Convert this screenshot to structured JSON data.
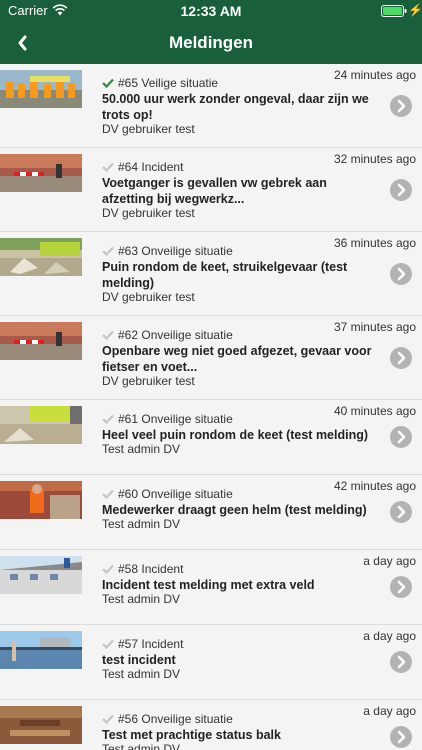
{
  "status_bar": {
    "carrier": "Carrier",
    "time": "12:33 AM"
  },
  "nav": {
    "title": "Meldingen"
  },
  "meldingen": [
    {
      "number": "#65",
      "type": "Veilige situatie",
      "time": "24 minutes ago",
      "title": "50.000 uur werk zonder ongeval, daar zijn we trots op!",
      "author": "DV gebruiker test",
      "checked": true
    },
    {
      "number": "#64",
      "type": "Incident",
      "time": "32 minutes ago",
      "title": "Voetganger is gevallen vw gebrek aan afzetting bij wegwerkz...",
      "author": "DV gebruiker test",
      "checked": false
    },
    {
      "number": "#63",
      "type": "Onveilige situatie",
      "time": "36 minutes ago",
      "title": "Puin rondom de keet, struikelgevaar (test melding)",
      "author": "DV gebruiker test",
      "checked": false
    },
    {
      "number": "#62",
      "type": "Onveilige situatie",
      "time": "37 minutes ago",
      "title": "Openbare weg niet goed afgezet, gevaar voor fietser en voet...",
      "author": "DV gebruiker test",
      "checked": false
    },
    {
      "number": "#61",
      "type": "Onveilige situatie",
      "time": "40 minutes ago",
      "title": "Heel veel puin rondom de keet (test melding)",
      "author": "Test admin DV",
      "checked": false
    },
    {
      "number": "#60",
      "type": "Onveilige situatie",
      "time": "42 minutes ago",
      "title": "Medewerker draagt geen helm (test melding)",
      "author": "Test admin DV",
      "checked": false
    },
    {
      "number": "#58",
      "type": "Incident",
      "time": "a day ago",
      "title": "Incident test melding met extra veld",
      "author": "Test admin DV",
      "checked": false
    },
    {
      "number": "#57",
      "type": "Incident",
      "time": "a day ago",
      "title": "test incident",
      "author": "Test admin DV",
      "checked": false
    },
    {
      "number": "#56",
      "type": "Onveilige situatie",
      "time": "a day ago",
      "title": "Test met prachtige status balk",
      "author": "Test admin DV",
      "checked": false
    }
  ],
  "colors": {
    "header": "#1a5f3c",
    "check_done": "#2e8b3e",
    "check_pending": "#c4c4c4",
    "chevron": "#b3b3b3"
  },
  "icons": {
    "back": "chevron-left-icon",
    "row_action": "chevron-right-circle-icon",
    "status": "checkmark-icon"
  }
}
